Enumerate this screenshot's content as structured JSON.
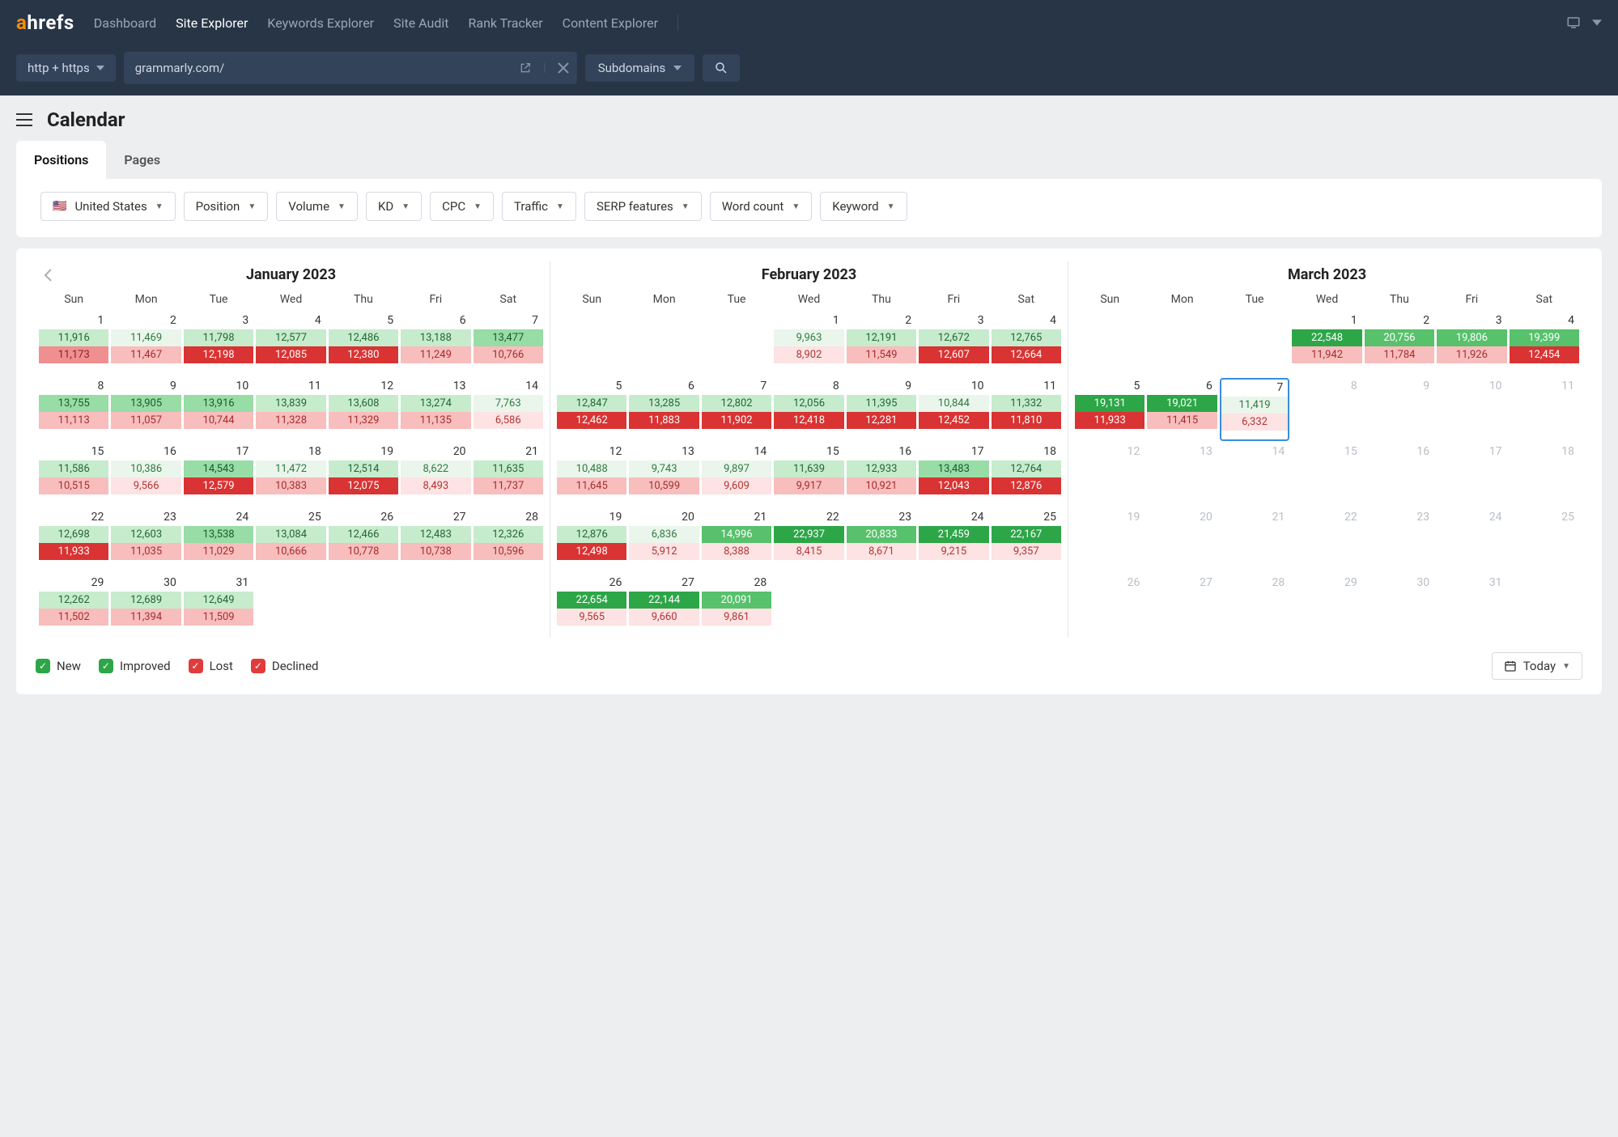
{
  "logo": {
    "a": "a",
    "rest": "hrefs"
  },
  "nav": {
    "items": [
      "Dashboard",
      "Site Explorer",
      "Keywords Explorer",
      "Site Audit",
      "Rank Tracker",
      "Content Explorer"
    ],
    "active_index": 1
  },
  "searchbar": {
    "protocol": "http + https",
    "url_value": "grammarly.com/",
    "scope": "Subdomains"
  },
  "page": {
    "title": "Calendar"
  },
  "tabs": {
    "items": [
      "Positions",
      "Pages"
    ],
    "active_index": 0
  },
  "filters": {
    "country": "United States",
    "list": [
      "Position",
      "Volume",
      "KD",
      "CPC",
      "Traffic",
      "SERP features",
      "Word count",
      "Keyword"
    ]
  },
  "dow": [
    "Sun",
    "Mon",
    "Tue",
    "Wed",
    "Thu",
    "Fri",
    "Sat"
  ],
  "legend": {
    "new": "New",
    "improved": "Improved",
    "lost": "Lost",
    "declined": "Declined"
  },
  "today_label": "Today",
  "months": [
    {
      "title": "January 2023",
      "show_prev": true,
      "weeks": [
        [
          {
            "d": 1,
            "g": "11,916",
            "gi": 1,
            "r": "11,173",
            "ri": 2
          },
          {
            "d": 2,
            "g": "11,469",
            "gi": 0,
            "r": "11,467",
            "ri": 1
          },
          {
            "d": 3,
            "g": "11,798",
            "gi": 1,
            "r": "12,198",
            "ri": 4
          },
          {
            "d": 4,
            "g": "12,577",
            "gi": 1,
            "r": "12,085",
            "ri": 4
          },
          {
            "d": 5,
            "g": "12,486",
            "gi": 1,
            "r": "12,380",
            "ri": 4
          },
          {
            "d": 6,
            "g": "13,188",
            "gi": 1,
            "r": "11,249",
            "ri": 1
          },
          {
            "d": 7,
            "g": "13,477",
            "gi": 2,
            "r": "10,766",
            "ri": 1
          }
        ],
        [
          {
            "d": 8,
            "g": "13,755",
            "gi": 2,
            "r": "11,113",
            "ri": 1
          },
          {
            "d": 9,
            "g": "13,905",
            "gi": 2,
            "r": "11,057",
            "ri": 1
          },
          {
            "d": 10,
            "g": "13,916",
            "gi": 2,
            "r": "10,744",
            "ri": 1
          },
          {
            "d": 11,
            "g": "13,839",
            "gi": 1,
            "r": "11,328",
            "ri": 1
          },
          {
            "d": 12,
            "g": "13,608",
            "gi": 1,
            "r": "11,329",
            "ri": 1
          },
          {
            "d": 13,
            "g": "13,274",
            "gi": 1,
            "r": "11,135",
            "ri": 1
          },
          {
            "d": 14,
            "g": "7,763",
            "gi": 0,
            "r": "6,586",
            "ri": 0
          }
        ],
        [
          {
            "d": 15,
            "g": "11,586",
            "gi": 1,
            "r": "10,515",
            "ri": 1
          },
          {
            "d": 16,
            "g": "10,386",
            "gi": 0,
            "r": "9,566",
            "ri": 0
          },
          {
            "d": 17,
            "g": "14,543",
            "gi": 2,
            "r": "12,579",
            "ri": 4
          },
          {
            "d": 18,
            "g": "11,472",
            "gi": 0,
            "r": "10,383",
            "ri": 1
          },
          {
            "d": 19,
            "g": "12,514",
            "gi": 1,
            "r": "12,075",
            "ri": 4
          },
          {
            "d": 20,
            "g": "8,622",
            "gi": 0,
            "r": "8,493",
            "ri": 0
          },
          {
            "d": 21,
            "g": "11,635",
            "gi": 1,
            "r": "11,737",
            "ri": 1
          }
        ],
        [
          {
            "d": 22,
            "g": "12,698",
            "gi": 1,
            "r": "11,933",
            "ri": 4
          },
          {
            "d": 23,
            "g": "12,603",
            "gi": 1,
            "r": "11,035",
            "ri": 1
          },
          {
            "d": 24,
            "g": "13,538",
            "gi": 2,
            "r": "11,029",
            "ri": 1
          },
          {
            "d": 25,
            "g": "13,084",
            "gi": 1,
            "r": "10,666",
            "ri": 1
          },
          {
            "d": 26,
            "g": "12,466",
            "gi": 1,
            "r": "10,778",
            "ri": 1
          },
          {
            "d": 27,
            "g": "12,483",
            "gi": 1,
            "r": "10,738",
            "ri": 1
          },
          {
            "d": 28,
            "g": "12,326",
            "gi": 1,
            "r": "10,596",
            "ri": 1
          }
        ],
        [
          {
            "d": 29,
            "g": "12,262",
            "gi": 1,
            "r": "11,502",
            "ri": 1
          },
          {
            "d": 30,
            "g": "12,689",
            "gi": 1,
            "r": "11,394",
            "ri": 1
          },
          {
            "d": 31,
            "g": "12,649",
            "gi": 1,
            "r": "11,509",
            "ri": 1
          },
          null,
          null,
          null,
          null
        ]
      ]
    },
    {
      "title": "February 2023",
      "show_prev": false,
      "weeks": [
        [
          null,
          null,
          null,
          {
            "d": 1,
            "g": "9,963",
            "gi": 0,
            "r": "8,902",
            "ri": 0
          },
          {
            "d": 2,
            "g": "12,191",
            "gi": 1,
            "r": "11,549",
            "ri": 1
          },
          {
            "d": 3,
            "g": "12,672",
            "gi": 1,
            "r": "12,607",
            "ri": 4
          },
          {
            "d": 4,
            "g": "12,765",
            "gi": 1,
            "r": "12,664",
            "ri": 4
          }
        ],
        [
          {
            "d": 5,
            "g": "12,847",
            "gi": 1,
            "r": "12,462",
            "ri": 4
          },
          {
            "d": 6,
            "g": "13,285",
            "gi": 1,
            "r": "11,883",
            "ri": 4
          },
          {
            "d": 7,
            "g": "12,802",
            "gi": 1,
            "r": "11,902",
            "ri": 4
          },
          {
            "d": 8,
            "g": "12,056",
            "gi": 1,
            "r": "12,418",
            "ri": 4
          },
          {
            "d": 9,
            "g": "11,395",
            "gi": 1,
            "r": "12,281",
            "ri": 4
          },
          {
            "d": 10,
            "g": "10,844",
            "gi": 0,
            "r": "12,452",
            "ri": 4
          },
          {
            "d": 11,
            "g": "11,332",
            "gi": 1,
            "r": "11,810",
            "ri": 4
          }
        ],
        [
          {
            "d": 12,
            "g": "10,488",
            "gi": 0,
            "r": "11,645",
            "ri": 1
          },
          {
            "d": 13,
            "g": "9,743",
            "gi": 0,
            "r": "10,599",
            "ri": 1
          },
          {
            "d": 14,
            "g": "9,897",
            "gi": 0,
            "r": "9,609",
            "ri": 0
          },
          {
            "d": 15,
            "g": "11,639",
            "gi": 1,
            "r": "9,917",
            "ri": 1
          },
          {
            "d": 16,
            "g": "12,933",
            "gi": 1,
            "r": "10,921",
            "ri": 1
          },
          {
            "d": 17,
            "g": "13,483",
            "gi": 2,
            "r": "12,043",
            "ri": 4
          },
          {
            "d": 18,
            "g": "12,764",
            "gi": 1,
            "r": "12,876",
            "ri": 4
          }
        ],
        [
          {
            "d": 19,
            "g": "12,876",
            "gi": 1,
            "r": "12,498",
            "ri": 4
          },
          {
            "d": 20,
            "g": "6,836",
            "gi": 0,
            "r": "5,912",
            "ri": 0
          },
          {
            "d": 21,
            "g": "14,996",
            "gi": 3,
            "r": "8,388",
            "ri": 0
          },
          {
            "d": 22,
            "g": "22,937",
            "gi": 4,
            "r": "8,415",
            "ri": 0
          },
          {
            "d": 23,
            "g": "20,833",
            "gi": 3,
            "r": "8,671",
            "ri": 0
          },
          {
            "d": 24,
            "g": "21,459",
            "gi": 4,
            "r": "9,215",
            "ri": 0
          },
          {
            "d": 25,
            "g": "22,167",
            "gi": 4,
            "r": "9,357",
            "ri": 0
          }
        ],
        [
          {
            "d": 26,
            "g": "22,654",
            "gi": 4,
            "r": "9,565",
            "ri": 0
          },
          {
            "d": 27,
            "g": "22,144",
            "gi": 4,
            "r": "9,660",
            "ri": 0
          },
          {
            "d": 28,
            "g": "20,091",
            "gi": 3,
            "r": "9,861",
            "ri": 0
          },
          null,
          null,
          null,
          null
        ]
      ]
    },
    {
      "title": "March 2023",
      "show_prev": false,
      "weeks": [
        [
          null,
          null,
          null,
          {
            "d": 1,
            "g": "22,548",
            "gi": 4,
            "r": "11,942",
            "ri": 1
          },
          {
            "d": 2,
            "g": "20,756",
            "gi": 3,
            "r": "11,784",
            "ri": 1
          },
          {
            "d": 3,
            "g": "19,806",
            "gi": 3,
            "r": "11,926",
            "ri": 1
          },
          {
            "d": 4,
            "g": "19,399",
            "gi": 3,
            "r": "12,454",
            "ri": 4
          }
        ],
        [
          {
            "d": 5,
            "g": "19,131",
            "gi": 4,
            "r": "11,933",
            "ri": 4
          },
          {
            "d": 6,
            "g": "19,021",
            "gi": 4,
            "r": "11,415",
            "ri": 1
          },
          {
            "d": 7,
            "g": "11,419",
            "gi": 0,
            "r": "6,332",
            "ri": 0,
            "hl": true
          },
          {
            "d": 8,
            "inactive": true
          },
          {
            "d": 9,
            "inactive": true
          },
          {
            "d": 10,
            "inactive": true
          },
          {
            "d": 11,
            "inactive": true
          }
        ],
        [
          {
            "d": 12,
            "inactive": true
          },
          {
            "d": 13,
            "inactive": true
          },
          {
            "d": 14,
            "inactive": true
          },
          {
            "d": 15,
            "inactive": true
          },
          {
            "d": 16,
            "inactive": true
          },
          {
            "d": 17,
            "inactive": true
          },
          {
            "d": 18,
            "inactive": true
          }
        ],
        [
          {
            "d": 19,
            "inactive": true
          },
          {
            "d": 20,
            "inactive": true
          },
          {
            "d": 21,
            "inactive": true
          },
          {
            "d": 22,
            "inactive": true
          },
          {
            "d": 23,
            "inactive": true
          },
          {
            "d": 24,
            "inactive": true
          },
          {
            "d": 25,
            "inactive": true
          }
        ],
        [
          {
            "d": 26,
            "inactive": true
          },
          {
            "d": 27,
            "inactive": true
          },
          {
            "d": 28,
            "inactive": true
          },
          {
            "d": 29,
            "inactive": true
          },
          {
            "d": 30,
            "inactive": true
          },
          {
            "d": 31,
            "inactive": true
          },
          null
        ]
      ]
    }
  ]
}
